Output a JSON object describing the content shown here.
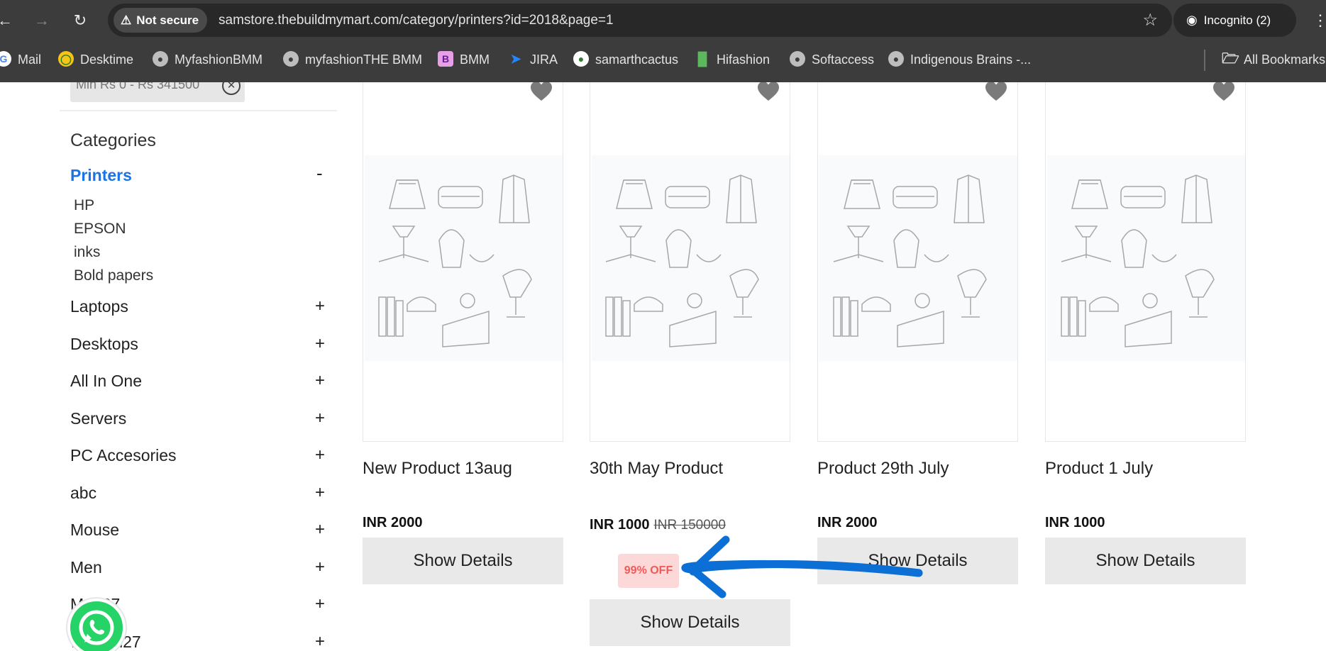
{
  "browser": {
    "security_label": "Not secure",
    "url": "samstore.thebuildmymart.com/category/printers?id=2018&page=1",
    "incognito_label": "Incognito (2)"
  },
  "bookmarks": {
    "items": [
      {
        "label": "Mail",
        "icon": "google-icon"
      },
      {
        "label": "Desktime",
        "icon": "desktime-icon"
      },
      {
        "label": "MyfashionBMM",
        "icon": "globe-icon"
      },
      {
        "label": "myfashionTHE BMM",
        "icon": "globe-icon"
      },
      {
        "label": "BMM",
        "icon": "bmm-icon"
      },
      {
        "label": "JIRA",
        "icon": "jira-icon"
      },
      {
        "label": "samarthcactus",
        "icon": "cactus-icon"
      },
      {
        "label": "Hifashion",
        "icon": "hifashion-icon"
      },
      {
        "label": "Softaccess",
        "icon": "globe-icon"
      },
      {
        "label": "Indigenous Brains -...",
        "icon": "globe-icon"
      }
    ],
    "all_bookmarks": "All Bookmarks"
  },
  "filter": {
    "chip_label": "Min Rs 0 - Rs 341500"
  },
  "sidebar": {
    "title": "Categories",
    "active_category": "Printers",
    "active_toggle": "-",
    "subcategories": [
      "HP",
      "EPSON",
      "inks",
      "Bold papers"
    ],
    "categories": [
      {
        "label": "Laptops",
        "toggle": "+"
      },
      {
        "label": "Desktops",
        "toggle": "+"
      },
      {
        "label": "All In One",
        "toggle": "+"
      },
      {
        "label": "Servers",
        "toggle": "+"
      },
      {
        "label": "PC Accesories",
        "toggle": "+"
      },
      {
        "label": "abc",
        "toggle": "+"
      },
      {
        "label": "Mouse",
        "toggle": "+"
      },
      {
        "label": "Men",
        "toggle": "+"
      },
      {
        "label": "Men27",
        "toggle": "+"
      },
      {
        "label": "women27",
        "toggle": "+"
      }
    ]
  },
  "products": [
    {
      "name": "New Product 13aug",
      "price": "INR 2000",
      "old_price": "",
      "discount": "",
      "button": "Show Details"
    },
    {
      "name": "30th May Product",
      "price": "INR 1000",
      "old_price": "INR 150000",
      "discount": "99% OFF",
      "button": "Show Details"
    },
    {
      "name": "Product 29th July",
      "price": "INR 2000",
      "old_price": "",
      "discount": "",
      "button": "Show Details"
    },
    {
      "name": "Product 1 July",
      "price": "INR 1000",
      "old_price": "",
      "discount": "",
      "button": "Show Details"
    }
  ],
  "annotation": {
    "arrow_color": "#0b6fd6"
  }
}
